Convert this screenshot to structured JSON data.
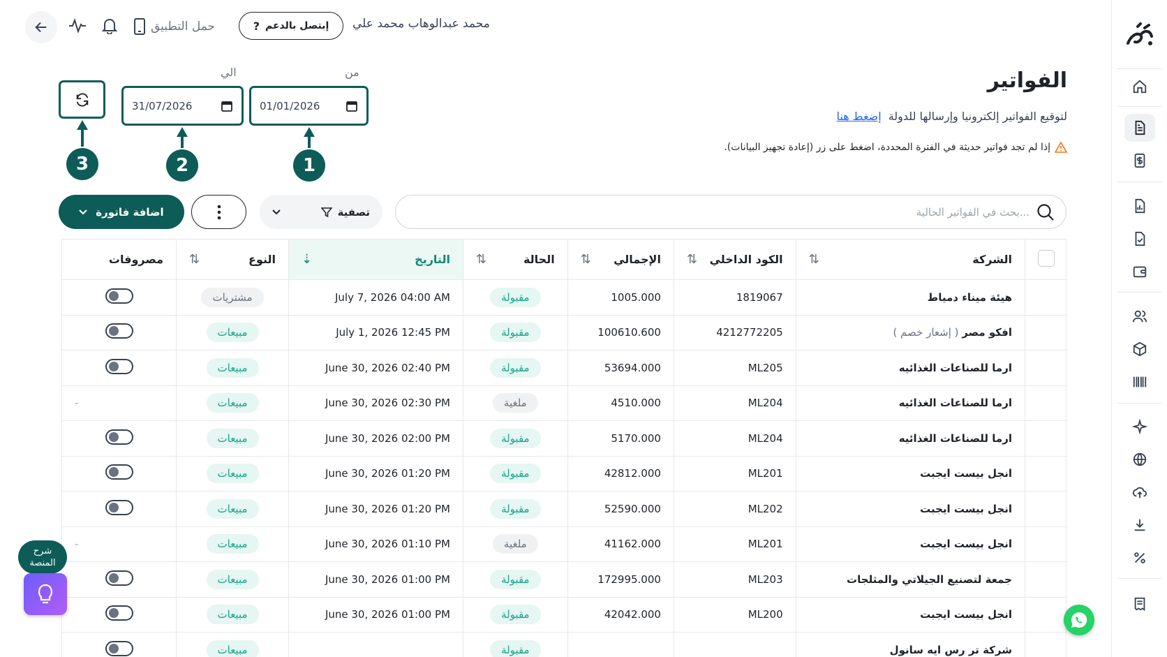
{
  "topbar": {
    "user_name": "محمد عبدالوهاب محمد علي",
    "support_label": "إبتصل بالدعم",
    "app_label": "حمل التطبيق"
  },
  "header": {
    "title": "الفواتير",
    "subtitle": "لتوقيع الفواتير إلكترونيا وإرسالها للدولة",
    "link": "إضغط هنا",
    "warning": "إذا لم تجد فواتير حديثة في الفترة المحددة، اضغط على زر (إعادة تجهيز البيانات)."
  },
  "dates": {
    "from_label": "من",
    "to_label": "الي",
    "from_value": "01/01/2026",
    "to_value": "31/07/2026"
  },
  "annotations": [
    "1",
    "2",
    "3"
  ],
  "toolbar": {
    "add_invoice": "اضافة فاتورة",
    "filter": "تصفية",
    "search_placeholder": "بحث في الفواتير الحالية..."
  },
  "table": {
    "headers": {
      "company": "الشركة",
      "internal_code": "الكود الداخلي",
      "total": "الإجمالي",
      "status": "الحالة",
      "date": "التاريخ",
      "type": "النوع",
      "expenses": "مصروفات"
    },
    "rows": [
      {
        "company": "هيئة ميناء دمياط",
        "note": "",
        "code": "1819067",
        "total": "1005.000",
        "status": "مقبولة",
        "status_kind": "accepted",
        "date": "July 7, 2026 04:00 AM",
        "type": "مشتريات",
        "type_kind": "purchases",
        "expense": "toggle"
      },
      {
        "company": "افكو مصر",
        "note": "( إشعار خصم )",
        "code": "4212772205",
        "total": "100610.600",
        "status": "مقبولة",
        "status_kind": "accepted",
        "date": "July 1, 2026 12:45 PM",
        "type": "مبيعات",
        "type_kind": "sales",
        "expense": "toggle"
      },
      {
        "company": "ارما للصناعات الغذائيه",
        "note": "",
        "code": "ML205",
        "total": "53694.000",
        "status": "مقبولة",
        "status_kind": "accepted",
        "date": "June 30, 2026 02:40 PM",
        "type": "مبيعات",
        "type_kind": "sales",
        "expense": "toggle"
      },
      {
        "company": "ارما للصناعات الغذائيه",
        "note": "",
        "code": "ML204",
        "total": "4510.000",
        "status": "ملغية",
        "status_kind": "cancelled",
        "date": "June 30, 2026 02:30 PM",
        "type": "مبيعات",
        "type_kind": "sales",
        "expense": "-"
      },
      {
        "company": "ارما للصناعات الغذائيه",
        "note": "",
        "code": "ML204",
        "total": "5170.000",
        "status": "مقبولة",
        "status_kind": "accepted",
        "date": "June 30, 2026 02:00 PM",
        "type": "مبيعات",
        "type_kind": "sales",
        "expense": "toggle"
      },
      {
        "company": "انجل بيست ايجبت",
        "note": "",
        "code": "ML201",
        "total": "42812.000",
        "status": "مقبولة",
        "status_kind": "accepted",
        "date": "June 30, 2026 01:20 PM",
        "type": "مبيعات",
        "type_kind": "sales",
        "expense": "toggle"
      },
      {
        "company": "انجل بيست ايجبت",
        "note": "",
        "code": "ML202",
        "total": "52590.000",
        "status": "مقبولة",
        "status_kind": "accepted",
        "date": "June 30, 2026 01:20 PM",
        "type": "مبيعات",
        "type_kind": "sales",
        "expense": "toggle"
      },
      {
        "company": "انجل بيست ايجبت",
        "note": "",
        "code": "ML201",
        "total": "41162.000",
        "status": "ملغية",
        "status_kind": "cancelled",
        "date": "June 30, 2026 01:10 PM",
        "type": "مبيعات",
        "type_kind": "sales",
        "expense": "-"
      },
      {
        "company": "جمعة لتصنيع الجيلاتي والمثلجات",
        "note": "",
        "code": "ML203",
        "total": "172995.000",
        "status": "مقبولة",
        "status_kind": "accepted",
        "date": "June 30, 2026 01:00 PM",
        "type": "مبيعات",
        "type_kind": "sales",
        "expense": "toggle"
      },
      {
        "company": "انجل بيست ايجبت",
        "note": "",
        "code": "ML200",
        "total": "42042.000",
        "status": "مقبولة",
        "status_kind": "accepted",
        "date": "June 30, 2026 01:00 PM",
        "type": "مبيعات",
        "type_kind": "sales",
        "expense": "toggle"
      },
      {
        "company": "شركة تر رس ايه سانول",
        "note": "",
        "code": "",
        "total": "",
        "status": "مقبولة",
        "status_kind": "accepted",
        "date": "",
        "type": "مبيعات",
        "type_kind": "sales",
        "expense": "toggle"
      }
    ]
  },
  "floating": {
    "help_line1": "شرح",
    "help_line2": "المنصة"
  },
  "colors": {
    "primary": "#0d5c58",
    "accent_green": "#17a589",
    "link_blue": "#2563eb"
  },
  "icons": [
    "home-icon",
    "invoice-icon",
    "dollar-doc-icon",
    "chart-doc-icon",
    "check-doc-icon",
    "wallet-icon",
    "users-icon",
    "box-icon",
    "barcode-icon",
    "sparkle-icon",
    "globe-icon",
    "upload-cloud-icon",
    "download-icon",
    "percent-icon",
    "receipt-icon"
  ]
}
